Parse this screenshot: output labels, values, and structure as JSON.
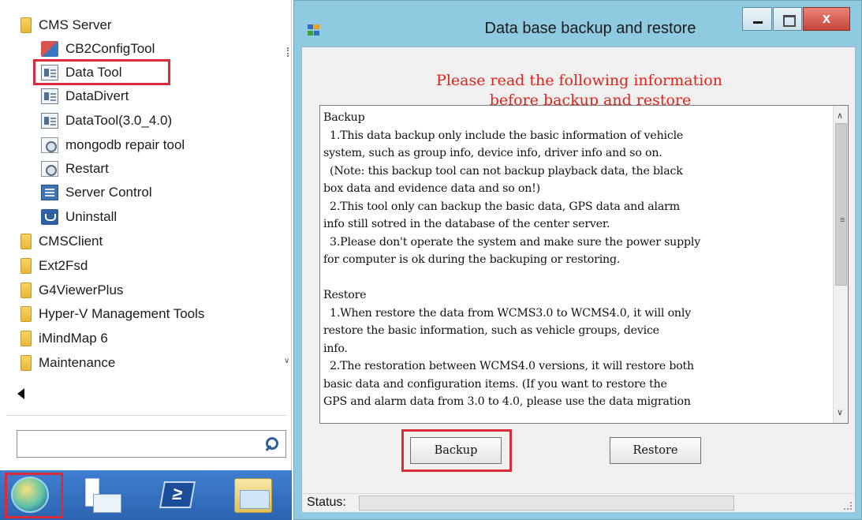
{
  "start_menu": {
    "items": [
      {
        "label": "CMS Server",
        "icon": "folder-icon"
      },
      {
        "label": "CB2ConfigTool",
        "icon": "config-tool-icon"
      },
      {
        "label": "Data Tool",
        "icon": "app-icon"
      },
      {
        "label": "DataDivert",
        "icon": "app-icon"
      },
      {
        "label": "DataTool(3.0_4.0)",
        "icon": "app-icon"
      },
      {
        "label": "mongodb repair tool",
        "icon": "gear-icon"
      },
      {
        "label": "Restart",
        "icon": "gear-icon"
      },
      {
        "label": "Server Control",
        "icon": "server-control-icon"
      },
      {
        "label": "Uninstall",
        "icon": "uninstall-icon"
      },
      {
        "label": "CMSClient",
        "icon": "folder-icon"
      },
      {
        "label": "Ext2Fsd",
        "icon": "folder-icon"
      },
      {
        "label": "G4ViewerPlus",
        "icon": "folder-icon"
      },
      {
        "label": "Hyper-V Management Tools",
        "icon": "folder-icon"
      },
      {
        "label": "iMindMap 6",
        "icon": "folder-icon"
      },
      {
        "label": "Maintenance",
        "icon": "folder-icon"
      }
    ],
    "search": {
      "value": "",
      "icon": "search-icon"
    },
    "back_icon": "back-arrow-icon"
  },
  "taskbar": {
    "buttons": [
      "start-orb-icon",
      "server-manager-icon",
      "powershell-icon",
      "file-explorer-icon"
    ],
    "powershell_glyph": "≥"
  },
  "dialog": {
    "title": "Data base backup and restore",
    "close_label": "x",
    "heading_line1": "Please read the following information",
    "heading_line2": "before backup and restore",
    "text_lines": [
      "Backup",
      "1.This data backup only include the basic information of vehicle",
      "system, such as group info, device info, driver info and so on.",
      "(Note: this backup tool can not backup playback data, the black",
      "box data and evidence data and so on!)",
      "2.This tool only can backup the basic data, GPS data and alarm",
      "info still sotred in the database of the center server.",
      "3.Please don't operate the system and make sure the power supply",
      "for computer is ok during the backuping or restoring.",
      "",
      "Restore",
      "1.When restore the data from WCMS3.0 to WCMS4.0, it will only",
      "restore the basic information, such as vehicle groups, device",
      "info.",
      "2.The restoration between WCMS4.0 versions, it will restore both",
      "basic data and configuration items. (If you want to restore the",
      "GPS and alarm data from 3.0 to 4.0, please use the data migration"
    ],
    "backup_label": "Backup",
    "restore_label": "Restore",
    "status_label": "Status:",
    "status_progress": 0
  },
  "colors": {
    "highlight": "#d92b3a",
    "heading": "#e0241c",
    "dialog_frame": "#8fcbe0",
    "taskbar": "#2c64b0"
  }
}
